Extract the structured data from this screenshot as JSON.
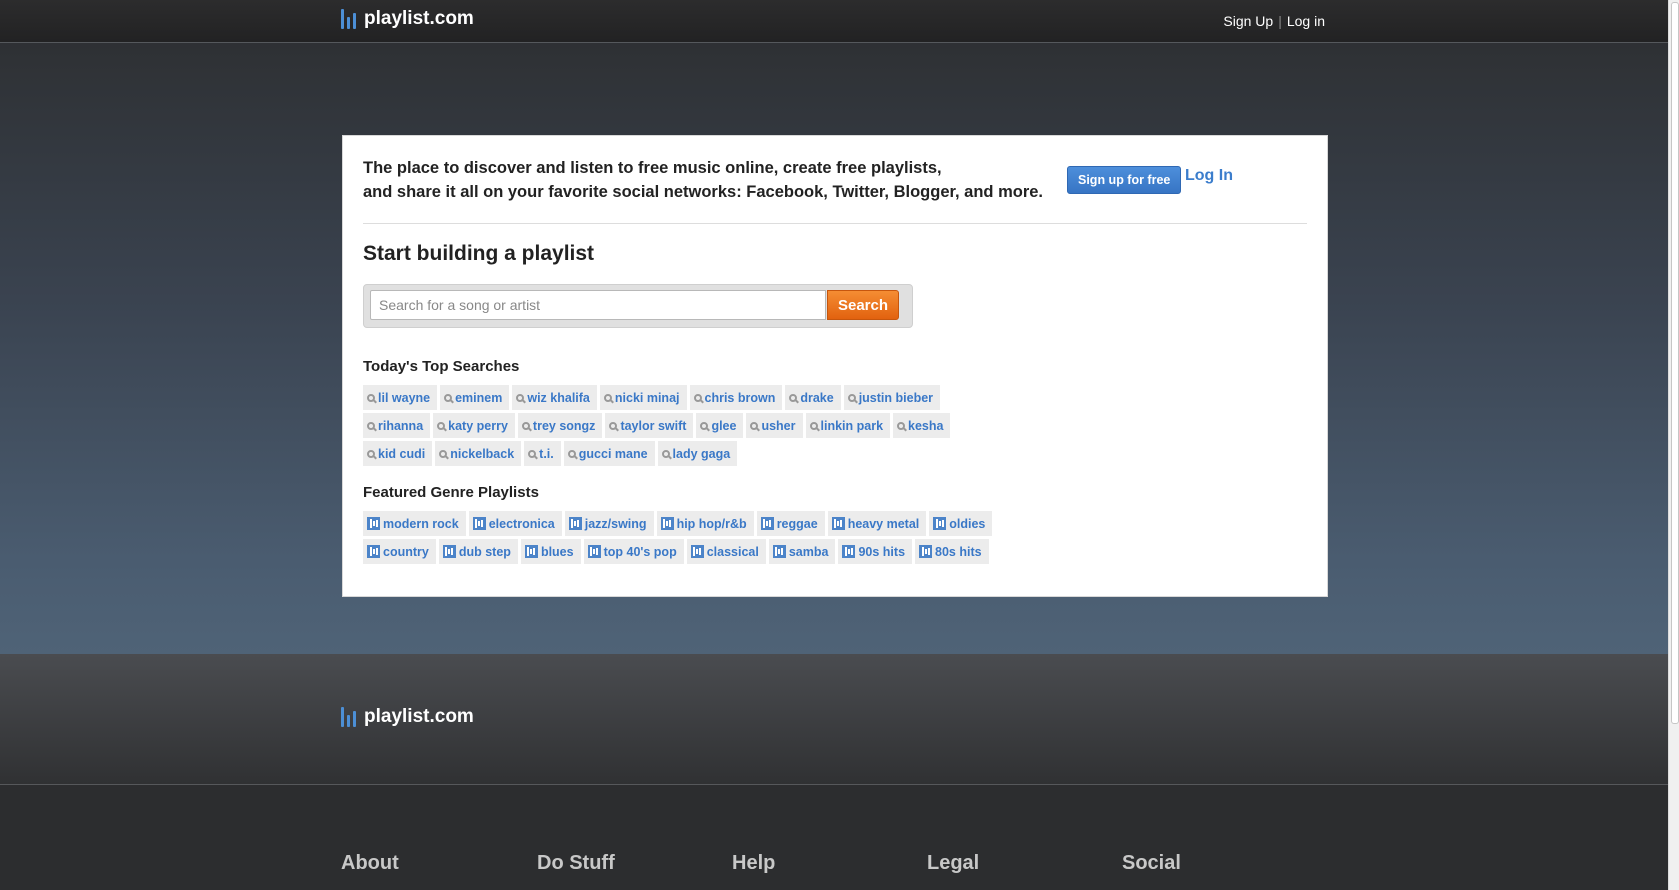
{
  "header": {
    "logo_text": "playlist.com",
    "signup_link": "Sign Up",
    "separator": "|",
    "login_link": "Log in"
  },
  "intro": {
    "line1": "The place to discover and listen to free music online, create free playlists,",
    "line2": "and share it all on your favorite social networks: Facebook, Twitter, Blogger, and more.",
    "signup_button": "Sign up for free",
    "login_link": "Log In"
  },
  "builder": {
    "heading": "Start building a playlist",
    "search_placeholder": "Search for a song or artist",
    "search_button": "Search"
  },
  "top_searches": {
    "heading": "Today's Top Searches",
    "icon": "search-icon",
    "items": [
      "lil wayne",
      "eminem",
      "wiz khalifa",
      "nicki minaj",
      "chris brown",
      "drake",
      "justin bieber",
      "rihanna",
      "katy perry",
      "trey songz",
      "taylor swift",
      "glee",
      "usher",
      "linkin park",
      "kesha",
      "kid cudi",
      "nickelback",
      "t.i.",
      "gucci mane",
      "lady gaga"
    ]
  },
  "genres": {
    "heading": "Featured Genre Playlists",
    "icon": "playlist-icon",
    "items": [
      "modern rock",
      "electronica",
      "jazz/swing",
      "hip hop/r&b",
      "reggae",
      "heavy metal",
      "oldies",
      "country",
      "dub step",
      "blues",
      "top 40's pop",
      "classical",
      "samba",
      "90s hits",
      "80s hits"
    ]
  },
  "footer": {
    "logo_text": "playlist.com",
    "columns": [
      "About",
      "Do Stuff",
      "Help",
      "Legal",
      "Social"
    ]
  },
  "colors": {
    "link_blue": "#3a78c7",
    "search_orange": "#e2620f",
    "signup_blue": "#3775c4"
  }
}
